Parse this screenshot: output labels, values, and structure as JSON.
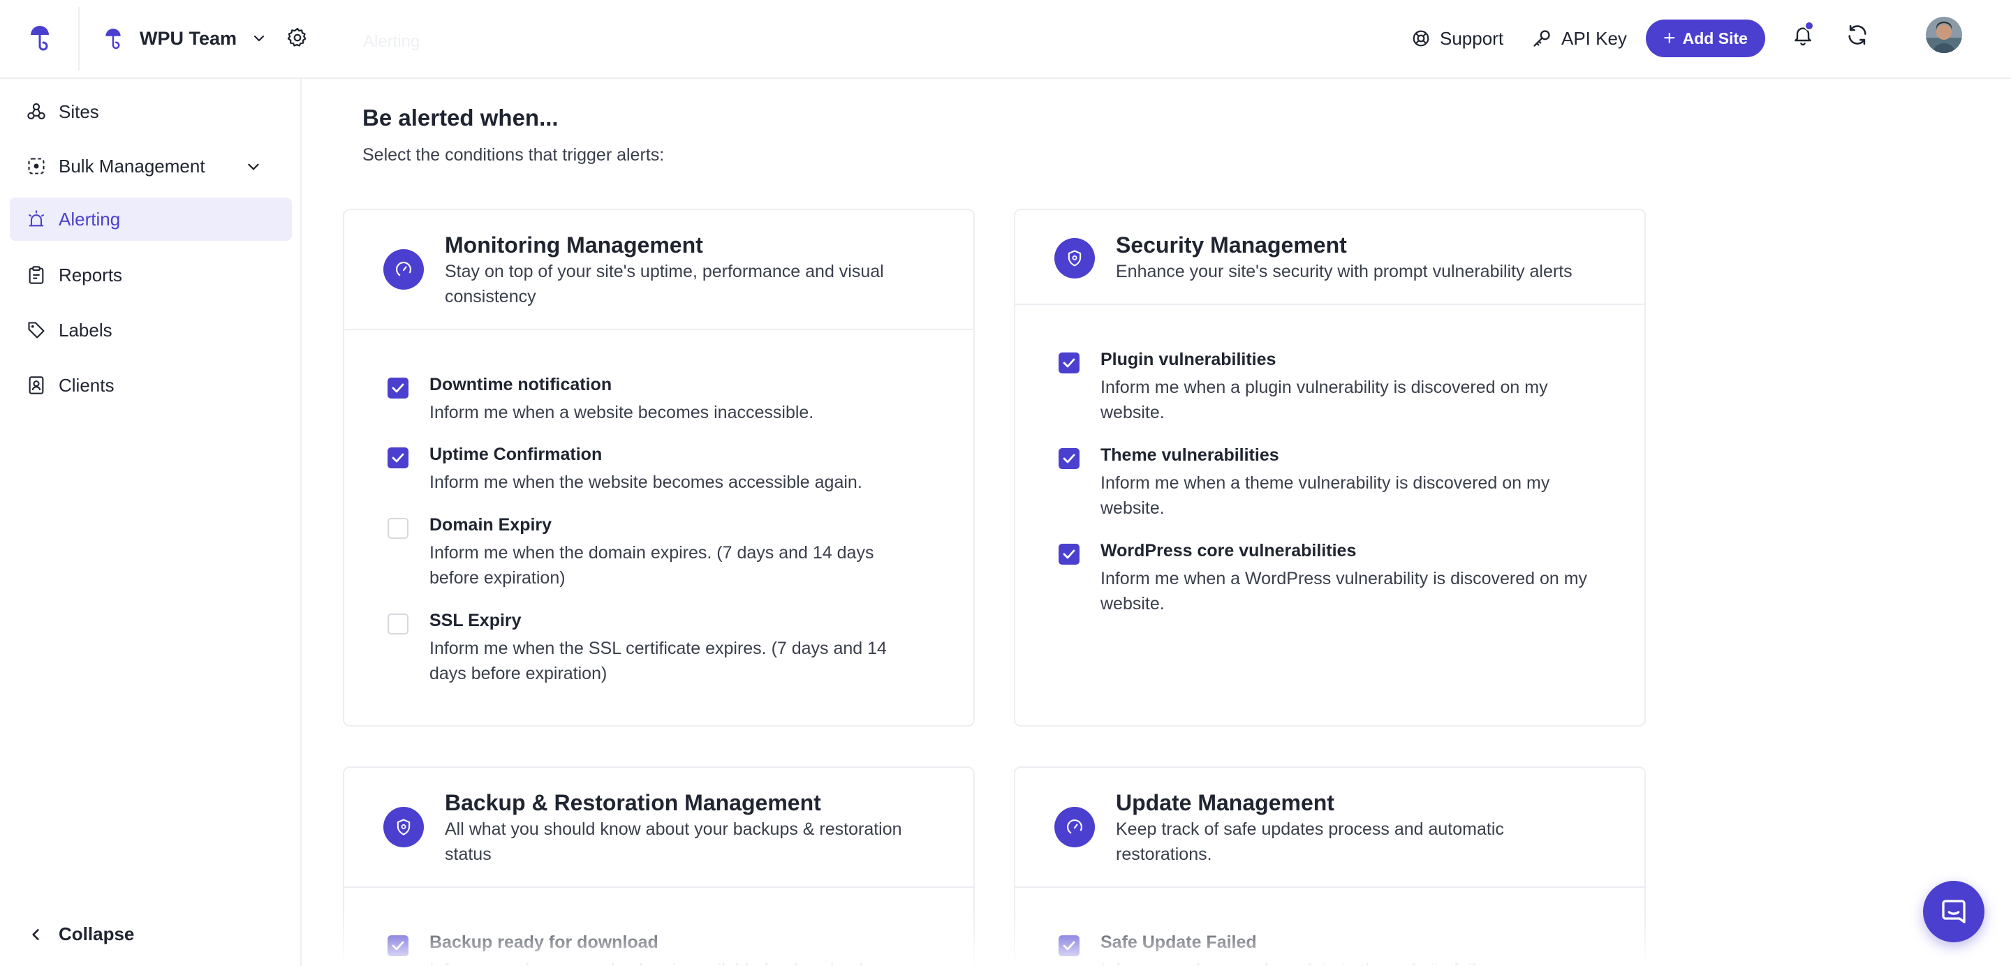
{
  "header": {
    "team_name": "WPU Team",
    "faint_title": "Alerting",
    "support_label": "Support",
    "api_key_label": "API Key",
    "add_site_label": "Add Site",
    "accent_color": "#4b3fcf"
  },
  "sidebar": {
    "items": [
      {
        "label": "Sites",
        "icon": "sites-icon"
      },
      {
        "label": "Bulk Management",
        "icon": "bulk-management-icon"
      },
      {
        "label": "Alerting",
        "icon": "alerting-icon",
        "active": true
      },
      {
        "label": "Reports",
        "icon": "reports-icon"
      },
      {
        "label": "Labels",
        "icon": "tag-icon"
      },
      {
        "label": "Clients",
        "icon": "clients-icon"
      }
    ],
    "collapse_label": "Collapse"
  },
  "main": {
    "title": "Be alerted when...",
    "subtitle": "Select the conditions that trigger alerts:",
    "cards": [
      {
        "title": "Monitoring Management",
        "description": "Stay on top of your site's uptime, performance and visual consistency",
        "icon": "gauge-icon",
        "options": [
          {
            "title": "Downtime notification",
            "description": "Inform me when a website becomes inaccessible.",
            "checked": true
          },
          {
            "title": "Uptime Confirmation",
            "description": "Inform me when the website becomes accessible again.",
            "checked": true
          },
          {
            "title": "Domain Expiry",
            "description": "Inform me when the domain expires. (7 days and 14 days before expiration)",
            "checked": false
          },
          {
            "title": "SSL Expiry",
            "description": "Inform me when the SSL certificate expires. (7 days and 14 days before expiration)",
            "checked": false
          }
        ]
      },
      {
        "title": "Security Management",
        "description": "Enhance your site's security with prompt vulnerability alerts",
        "icon": "shield-icon",
        "options": [
          {
            "title": "Plugin vulnerabilities",
            "description": "Inform me when a plugin vulnerability is discovered on my website.",
            "checked": true
          },
          {
            "title": "Theme vulnerabilities",
            "description": "Inform me when a theme vulnerability is discovered on my website.",
            "checked": true
          },
          {
            "title": "WordPress core vulnerabilities",
            "description": "Inform me when a WordPress vulnerability is discovered on my website.",
            "checked": true
          }
        ]
      },
      {
        "title": "Backup & Restoration Management",
        "description": "All what you should know about your backups & restoration status",
        "icon": "shield-icon",
        "options": [
          {
            "title": "Backup ready for download",
            "description": "Inform me when a new backup is available for download.",
            "checked": true
          }
        ]
      },
      {
        "title": "Update Management",
        "description": "Keep track of safe updates process and automatic restorations.",
        "icon": "gauge-icon",
        "options": [
          {
            "title": "Safe Update Failed",
            "description": "Inform me when a safe update to the website fails.",
            "checked": true
          }
        ]
      }
    ]
  }
}
